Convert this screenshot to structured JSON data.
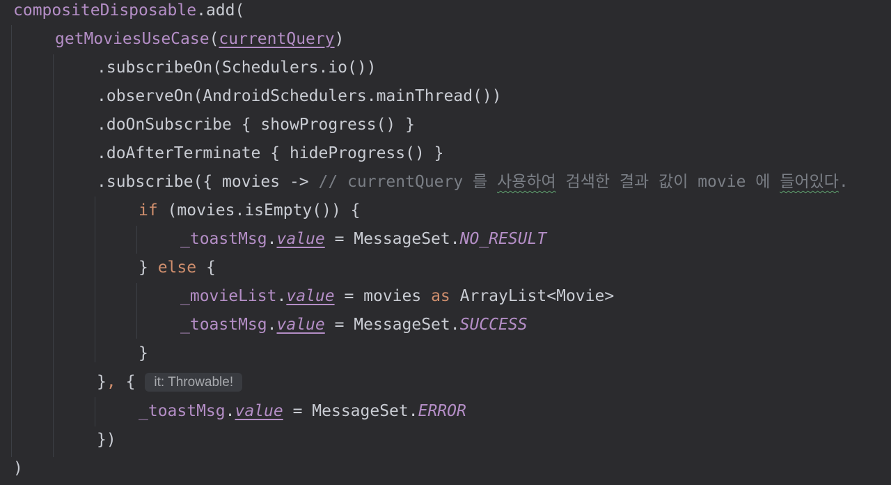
{
  "code": {
    "l1": {
      "a": "compositeDisposable",
      "b": ".add("
    },
    "l2": {
      "a": "getMoviesUseCase",
      "b": "(",
      "c": "currentQuery",
      "d": ")"
    },
    "l3": {
      "a": ".subscribeOn(Schedulers.io())"
    },
    "l4": {
      "a": ".observeOn(AndroidSchedulers.mainThread())"
    },
    "l5": {
      "a": ".doOnSubscribe { showProgress() }"
    },
    "l6": {
      "a": ".doAfterTerminate { hideProgress() }"
    },
    "l7": {
      "a": ".subscribe({ movies -> ",
      "b": "// currentQuery 를 ",
      "c": "사용하여",
      "d": " 검색한 결과 값이 movie 에 ",
      "e": "들어있다",
      "f": "."
    },
    "l8": {
      "a": "if",
      "b": " (movies.isEmpty()) {"
    },
    "l9": {
      "a": "_toastMsg",
      "b": ".",
      "c": "value",
      "d": " = MessageSet.",
      "e": "NO_RESULT"
    },
    "l10": {
      "a": "} ",
      "b": "else",
      "c": " {"
    },
    "l11": {
      "a": "_movieList",
      "b": ".",
      "c": "value",
      "d": " = movies ",
      "e": "as",
      "f": " ArrayList<Movie>"
    },
    "l12": {
      "a": "_toastMsg",
      "b": ".",
      "c": "value",
      "d": " = MessageSet.",
      "e": "SUCCESS"
    },
    "l13": {
      "a": "}"
    },
    "l14": {
      "a": "}",
      "b": ",",
      "c": " {",
      "hint": "it: Throwable!"
    },
    "l15": {
      "a": "_toastMsg",
      "b": ".",
      "c": "value",
      "d": " = MessageSet.",
      "e": "ERROR"
    },
    "l16": {
      "a": "})"
    },
    "l17": {
      "a": ")"
    }
  },
  "colors": {
    "background": "#2b2b2e",
    "function": "#b48ec6",
    "keyword": "#cf8e6d",
    "comment": "#7a7e85",
    "plain": "#c9ccd3"
  }
}
